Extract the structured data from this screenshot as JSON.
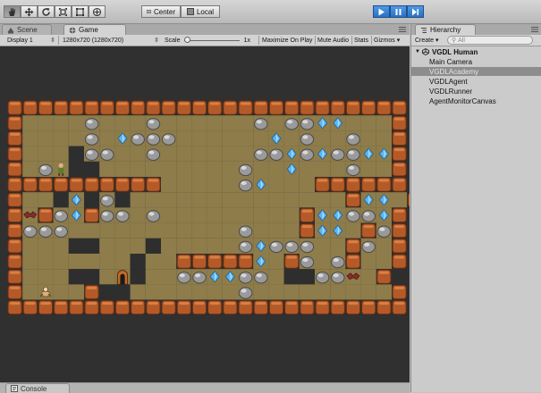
{
  "toolbar": {
    "tools": [
      "hand-icon",
      "move-icon",
      "rotate-icon",
      "scale-icon",
      "rect-tool-icon",
      "transform-icon"
    ],
    "pivot_label": "Center",
    "space_label": "Local"
  },
  "tabs": {
    "scene_label": "Scene",
    "game_label": "Game"
  },
  "gamebar": {
    "display": "Display 1",
    "resolution": "1280x720 (1280x720)",
    "scale_label": "Scale",
    "scale_value": "1x",
    "maximize_label": "Maximize On Play",
    "mute_label": "Mute Audio",
    "stats_label": "Stats",
    "gizmos_label": "Gizmos"
  },
  "hierarchy": {
    "tab_label": "Hierarchy",
    "create_label": "Create",
    "search_placeholder": "All",
    "scene_name": "VGDL Human",
    "items": [
      {
        "label": "Main Camera",
        "selected": false
      },
      {
        "label": "VGDLAcademy",
        "selected": true
      },
      {
        "label": "VGDLAgent",
        "selected": false
      },
      {
        "label": "VGDLRunner",
        "selected": false
      },
      {
        "label": "AgentMonitorCanvas",
        "selected": false
      }
    ]
  },
  "console": {
    "label": "Console"
  },
  "game": {
    "legend": {
      "W": "wall-block",
      "#": "background",
      ".": "dirt",
      "B": "boulder",
      "D": "diamond",
      "A": "avatar",
      "S": "scorpion",
      "R": "bat",
      "E": "exit-door"
    },
    "map": [
      "WWWWWWWWWWWWWWWWWWWWWWWWWW",
      "W....B...B......B.BBDD...W",
      "W....B.DBBB......D.B..B..W",
      "W...#BB..B......BBDBDBBDDW",
      "W.BA##.........B..D...B..W",
      "WWWWWWWWWW.....BD...WWWWWW",
      "W..#D#B#..............WDD.W",
      "WRWBDWBB.B.........WDDBBDW",
      "WBBB...........B...WDD.WBW",
      "W...##...#.....BDBBB..WB.W",
      "W.......#..WWWWWD.WB.BW..W",
      "W...##.E#..BBDDBB.##BBR.W",
      "W.S..W##.......B.........W",
      "WWWWWWWWWWWWWWWWWWWWWWWWWW"
    ]
  }
}
